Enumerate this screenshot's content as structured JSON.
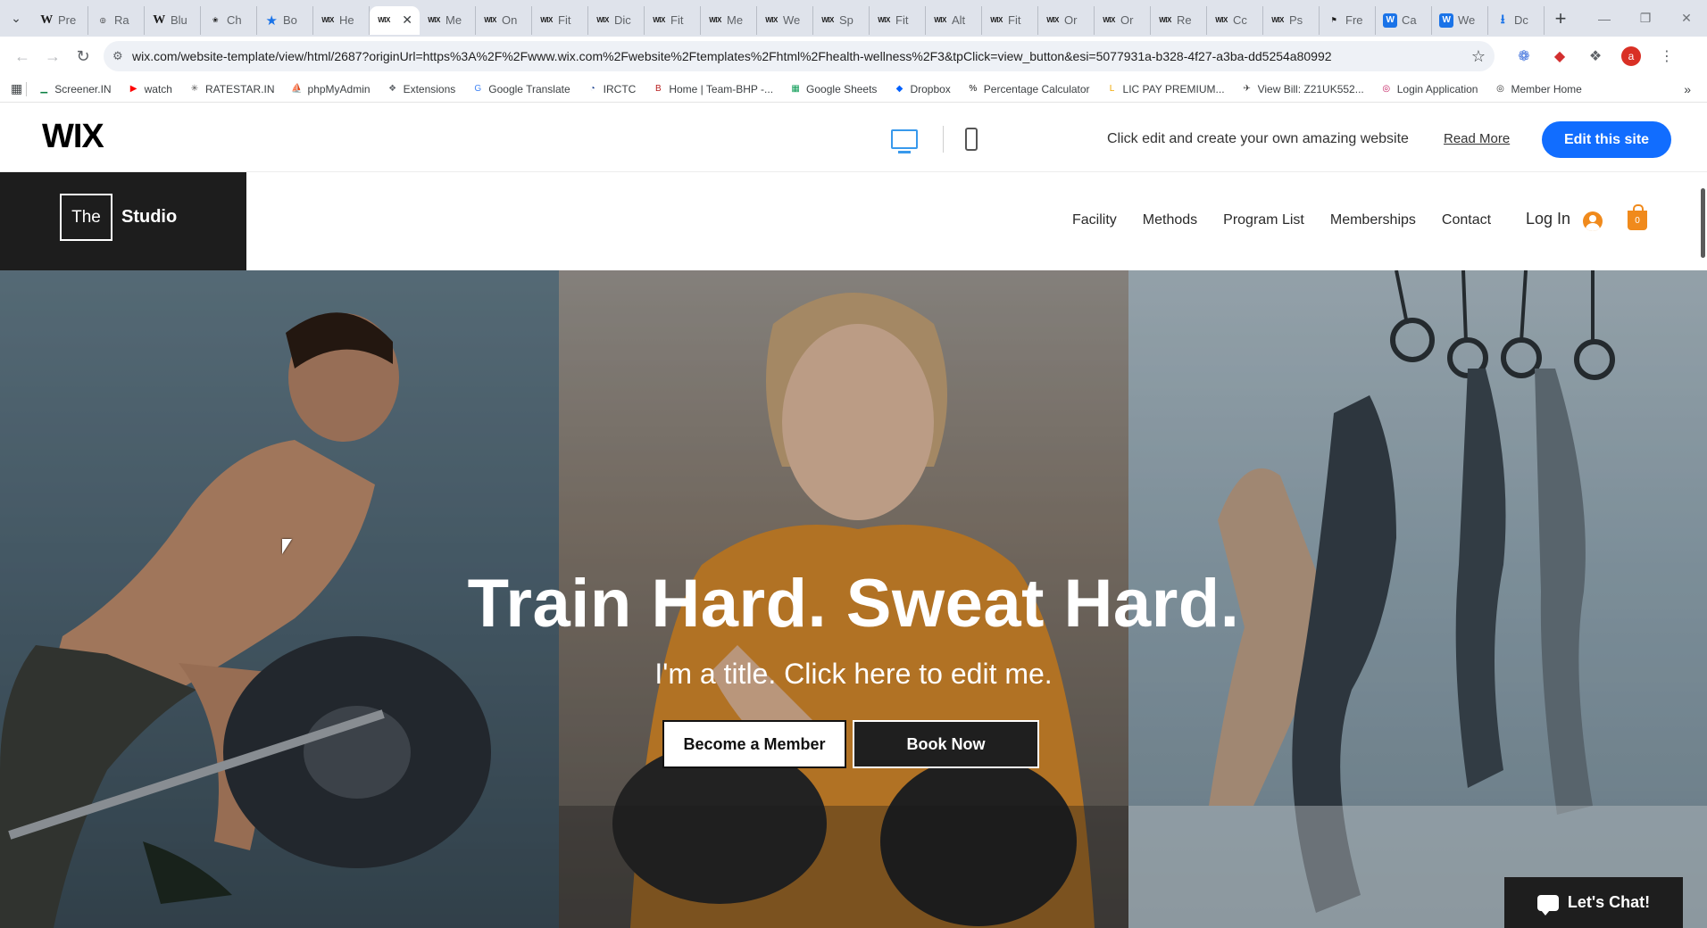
{
  "browser": {
    "tabs": [
      {
        "favicon": "W",
        "title": "Pre"
      },
      {
        "favicon": "globe",
        "title": "Ra"
      },
      {
        "favicon": "W",
        "title": "Blu"
      },
      {
        "favicon": "chatgpt",
        "title": "Ch"
      },
      {
        "favicon": "star",
        "title": "Bo"
      },
      {
        "favicon": "wix",
        "title": "He"
      },
      {
        "favicon": "wix",
        "title": "",
        "active": true
      },
      {
        "favicon": "wix",
        "title": "Me"
      },
      {
        "favicon": "wix",
        "title": "On"
      },
      {
        "favicon": "wix",
        "title": "Fit"
      },
      {
        "favicon": "wix",
        "title": "Dic"
      },
      {
        "favicon": "wix",
        "title": "Fit"
      },
      {
        "favicon": "wix",
        "title": "Me"
      },
      {
        "favicon": "wix",
        "title": "We"
      },
      {
        "favicon": "wix",
        "title": "Sp"
      },
      {
        "favicon": "wix",
        "title": "Fit"
      },
      {
        "favicon": "wix",
        "title": "Alt"
      },
      {
        "favicon": "wix",
        "title": "Fit"
      },
      {
        "favicon": "wix",
        "title": "Or"
      },
      {
        "favicon": "wix",
        "title": "Or"
      },
      {
        "favicon": "wix",
        "title": "Re"
      },
      {
        "favicon": "wix",
        "title": "Cc"
      },
      {
        "favicon": "wix",
        "title": "Ps"
      },
      {
        "favicon": "F",
        "title": "Fre"
      },
      {
        "favicon": "blue",
        "title": "Ca"
      },
      {
        "favicon": "blue",
        "title": "We"
      },
      {
        "favicon": "download",
        "title": "Dc"
      }
    ],
    "url": "wix.com/website-template/view/html/2687?originUrl=https%3A%2F%2Fwww.wix.com%2Fwebsite%2Ftemplates%2Fhtml%2Fhealth-wellness%2F3&tpClick=view_button&esi=5077931a-b328-4f27-a3ba-dd5254a80992",
    "profile_initial": "a",
    "bookmarks": [
      {
        "icon": "chart",
        "label": "Screener.IN"
      },
      {
        "icon": "youtube",
        "label": "watch"
      },
      {
        "icon": "star",
        "label": "RATESTAR.IN"
      },
      {
        "icon": "php",
        "label": "phpMyAdmin"
      },
      {
        "icon": "puzzle",
        "label": "Extensions"
      },
      {
        "icon": "translate",
        "label": "Google Translate"
      },
      {
        "icon": "irctc",
        "label": "IRCTC"
      },
      {
        "icon": "bhp",
        "label": "Home | Team-BHP -..."
      },
      {
        "icon": "sheets",
        "label": "Google Sheets"
      },
      {
        "icon": "dropbox",
        "label": "Dropbox"
      },
      {
        "icon": "percent",
        "label": "Percentage Calculator"
      },
      {
        "icon": "lic",
        "label": "LIC PAY PREMIUM..."
      },
      {
        "icon": "bill",
        "label": "View Bill: Z21UK552..."
      },
      {
        "icon": "login",
        "label": "Login Application"
      },
      {
        "icon": "globe",
        "label": "Member Home"
      }
    ]
  },
  "wix_bar": {
    "logo": "WIX",
    "message": "Click edit and create your own amazing website",
    "read_more": "Read More",
    "edit_button": "Edit this site"
  },
  "site": {
    "brand_the": "The",
    "brand_name": "Studio",
    "nav": [
      "Facility",
      "Methods",
      "Program List",
      "Memberships",
      "Contact"
    ],
    "login": "Log In",
    "cart_count": "0",
    "accent": "#f08a1c"
  },
  "hero": {
    "title": "Train Hard. Sweat Hard.",
    "subtitle": "I'm a title. Click here to edit me.",
    "primary_button": "Become a Member",
    "secondary_button": "Book Now"
  },
  "chat": {
    "label": "Let's Chat!"
  }
}
